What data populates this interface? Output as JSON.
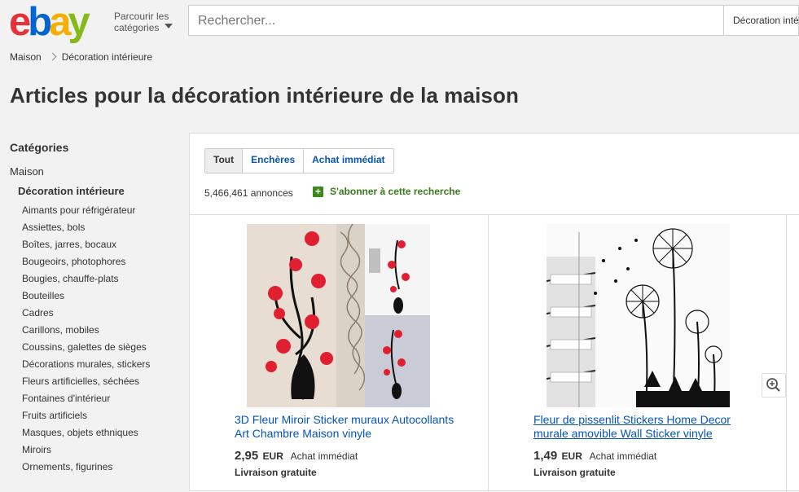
{
  "header": {
    "logo": {
      "e": "e",
      "b": "b",
      "a": "a",
      "y": "y"
    },
    "browse_line1": "Parcourir les",
    "browse_line2": "catégories",
    "search_placeholder": "Rechercher...",
    "search_category": "Décoration intérieure"
  },
  "breadcrumb": {
    "home": "Maison",
    "current": "Décoration intérieure"
  },
  "page_title": "Articles pour la décoration intérieure de la maison",
  "sidebar": {
    "heading": "Catégories",
    "level1": "Maison",
    "level2": "Décoration intérieure",
    "items": [
      "Aimants pour réfrigérateur",
      "Assiettes, bols",
      "Boîtes, jarres, bocaux",
      "Bougeoirs, photophores",
      "Bougies, chauffe-plats",
      "Bouteilles",
      "Cadres",
      "Carillons, mobiles",
      "Coussins, galettes de sièges",
      "Décorations murales, stickers",
      "Fleurs artificielles, séchées",
      "Fontaines d'intérieur",
      "Fruits artificiels",
      "Masques, objets ethniques",
      "Miroirs",
      "Ornements, figurines"
    ]
  },
  "tabs": [
    "Tout",
    "Enchères",
    "Achat immédiat"
  ],
  "results": {
    "count": "5,466,461 annonces",
    "subscribe": "S'abonner à cette recherche"
  },
  "listings": [
    {
      "title": "3D Fleur Miroir Sticker muraux Autocollants Art Chambre Maison vinyle",
      "price": "2,95",
      "currency": "EUR",
      "format": "Achat immédiat",
      "shipping": "Livraison gratuite"
    },
    {
      "title": "Fleur de pissenlit Stickers Home Decor murale amovible Wall Sticker vinyle",
      "price": "1,49",
      "currency": "EUR",
      "format": "Achat immédiat",
      "shipping": "Livraison gratuite"
    }
  ],
  "colors": {
    "link": "#0654ba",
    "ebay_red": "#e53238",
    "ebay_blue": "#0064d2",
    "ebay_yellow": "#f5af02",
    "ebay_green": "#86b817",
    "subscribe_green": "#3a7a1a"
  }
}
